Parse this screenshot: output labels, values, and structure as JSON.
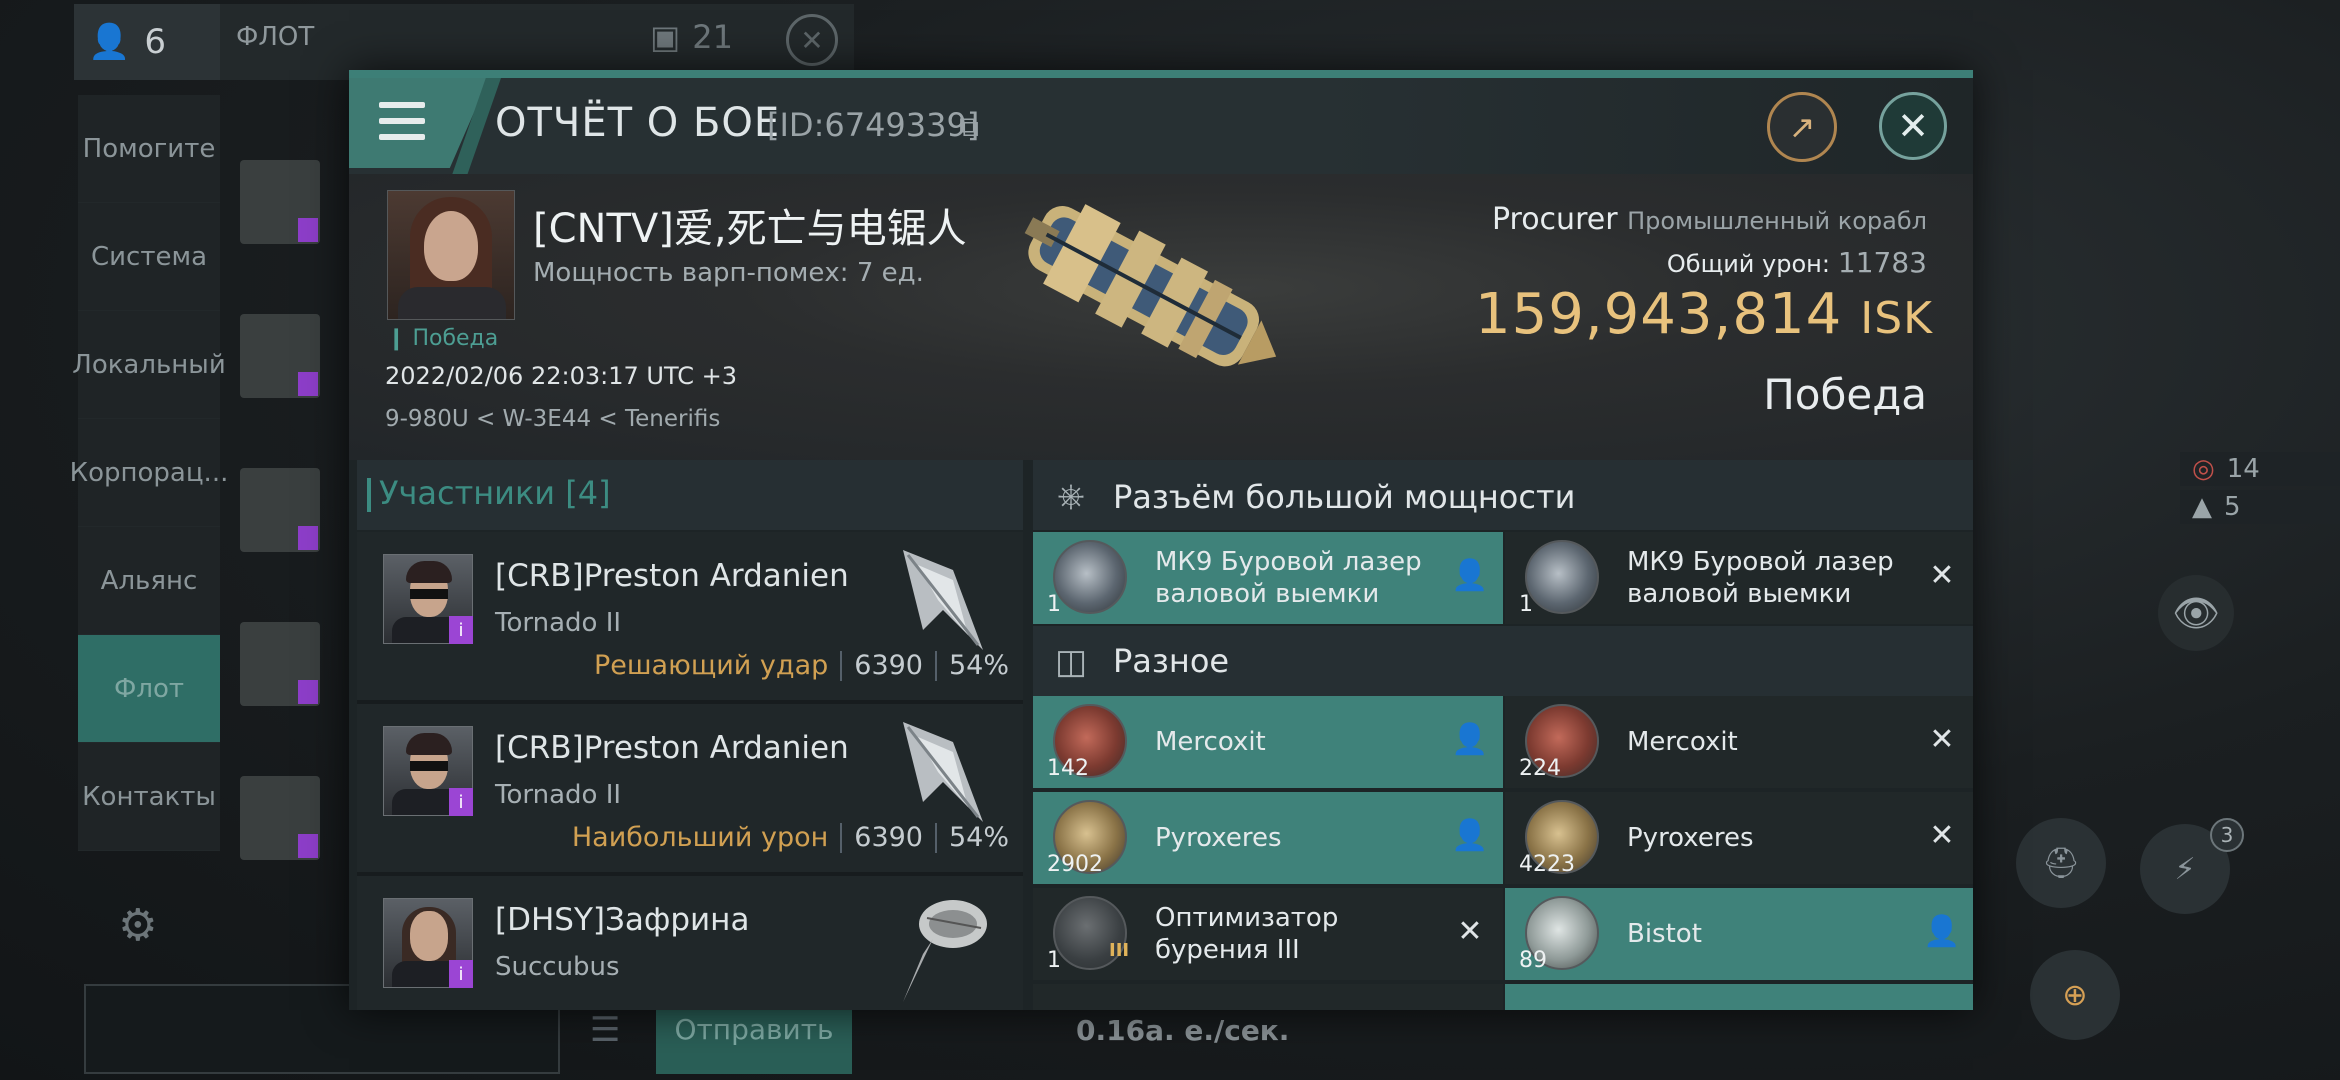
{
  "background": {
    "member_count": "6",
    "fleet_title": "ФЛОТ",
    "message_count": "21",
    "tabs": [
      {
        "label": "Помогите",
        "active": false
      },
      {
        "label": "Система",
        "active": false
      },
      {
        "label": "Локальный",
        "active": false
      },
      {
        "label": "Корпорац...",
        "active": false
      },
      {
        "label": "Альянс",
        "active": false
      },
      {
        "label": "Флот",
        "active": true
      },
      {
        "label": "Контакты",
        "active": false
      }
    ],
    "send_label": "Отправить",
    "rate_text": "0.16а. е./сек.",
    "stat_1": "14",
    "stat_2": "5",
    "module_badge": "3"
  },
  "report": {
    "title": "ОТЧЁТ О БОЕ",
    "id": "[ID:6749339]",
    "victim": {
      "name": "[CNTV]爱,死亡与电锯人",
      "warp_disrupt": "Мощность варп-помех: 7 ед.",
      "tag": "Победа",
      "datetime": "2022/02/06 22:03:17 UTC +3",
      "location": "9-980U < W-3E44 < Tenerifis"
    },
    "ship": {
      "name": "Procurer",
      "class": "Промышленный корабл",
      "damage_label": "Общий урон:",
      "damage_value": "11783",
      "isk_value": "159,943,814",
      "isk_unit": "ISK",
      "result": "Победа"
    },
    "participants": {
      "title": "Участники [4]",
      "rows": [
        {
          "name": "[CRB]Preston Ardanien",
          "ship": "Tornado II",
          "label": "Решающий удар",
          "damage": "6390",
          "percent": "54%"
        },
        {
          "name": "[CRB]Preston Ardanien",
          "ship": "Tornado II",
          "label": "Наибольший урон",
          "damage": "6390",
          "percent": "54%"
        },
        {
          "name": "[DHSY]Зафрина",
          "ship": "Succubus",
          "label": "",
          "damage": "",
          "percent": ""
        }
      ]
    },
    "sections": [
      {
        "title": "Разъём большой мощности",
        "items": [
          {
            "name": "МК9 Буровой лазер валовой выемки",
            "qty": "1",
            "status": "dropped",
            "highlight": true,
            "icon": "laser"
          },
          {
            "name": "МК9 Буровой лазер валовой выемки",
            "qty": "1",
            "status": "destroyed",
            "highlight": false,
            "icon": "laser"
          }
        ]
      },
      {
        "title": "Разное",
        "items": [
          {
            "name": "Mercoxit",
            "qty": "142",
            "status": "dropped",
            "highlight": true,
            "icon": "ore-red"
          },
          {
            "name": "Mercoxit",
            "qty": "224",
            "status": "destroyed",
            "highlight": false,
            "icon": "ore-red"
          },
          {
            "name": "Pyroxeres",
            "qty": "2902",
            "status": "dropped",
            "highlight": true,
            "icon": "ore-gold"
          },
          {
            "name": "Pyroxeres",
            "qty": "4223",
            "status": "destroyed",
            "highlight": false,
            "icon": "ore-gold"
          },
          {
            "name": "Оптимизатор бурения III",
            "qty": "1",
            "status": "destroyed",
            "highlight": false,
            "icon": "module",
            "meta": "III"
          },
          {
            "name": "Bistot",
            "qty": "89",
            "status": "dropped",
            "highlight": true,
            "icon": "ore-silver"
          }
        ]
      }
    ]
  },
  "icons": {
    "dropped": "person-icon",
    "destroyed": "x-icon"
  },
  "colors": {
    "accent": "#3f827a",
    "isk": "#e8c27d",
    "final_blow": "#d1a052",
    "badge": "#9b45d4"
  }
}
